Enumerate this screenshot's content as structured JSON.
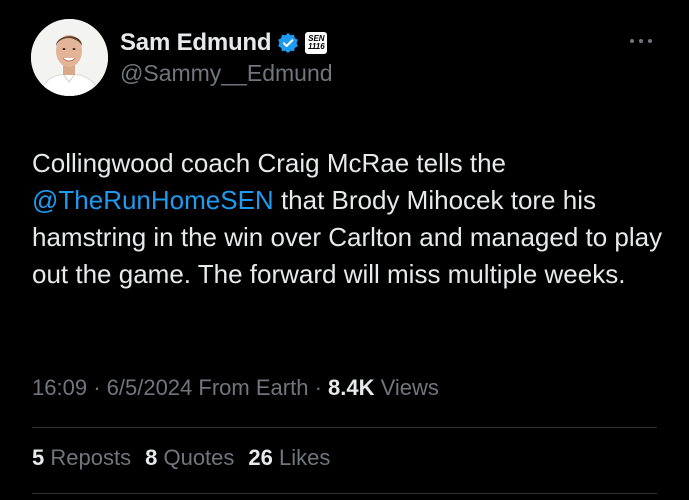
{
  "author": {
    "display_name": "Sam Edmund",
    "handle": "@Sammy__Edmund",
    "affiliate_badge": [
      "SEN",
      "1116"
    ]
  },
  "tweet": {
    "text_before_mention": "Collingwood coach Craig McRae tells the ",
    "mention": "@TheRunHomeSEN",
    "text_after_mention": " that Brody Mihocek tore his hamstring in the win over Carlton and managed to play out the game. The forward will miss multiple weeks."
  },
  "meta": {
    "time": "16:09",
    "separator": "·",
    "date": "6/5/2024",
    "source": "From Earth",
    "views_count": "8.4K",
    "views_label": "Views"
  },
  "stats": {
    "reposts_count": "5",
    "reposts_label": "Reposts",
    "quotes_count": "8",
    "quotes_label": "Quotes",
    "likes_count": "26",
    "likes_label": "Likes"
  },
  "icons": {
    "verified": "verified-badge-icon",
    "more": "more-options-icon"
  },
  "colors": {
    "background": "#000000",
    "text": "#e7e9ea",
    "secondary": "#71767b",
    "accent": "#1d9bf0",
    "divider": "#2f3336"
  }
}
